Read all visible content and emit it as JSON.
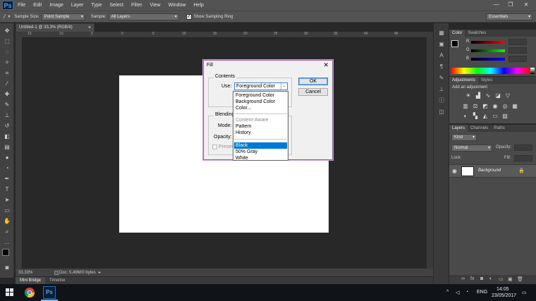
{
  "app": {
    "logo": "Ps",
    "menu": [
      "File",
      "Edit",
      "Image",
      "Layer",
      "Type",
      "Select",
      "Filter",
      "View",
      "Window",
      "Help"
    ]
  },
  "options_bar": {
    "sample_size_label": "Sample Size:",
    "sample_size_value": "Point Sample",
    "sample_label": "Sample:",
    "sample_value": "All Layers",
    "show_ring_label": "Show Sampling Ring",
    "workspace": "Essentials"
  },
  "document": {
    "tab_title": "Untitled-1 @ 33,3% (RGB/8)",
    "zoom": "33,33%",
    "doc_info": "Doc: 5,49M/0 bytes",
    "ruler_ticks": [
      "15",
      "10",
      "5",
      "0",
      "5",
      "10",
      "15",
      "20",
      "25",
      "30",
      "35",
      "40",
      "45"
    ]
  },
  "bottom_tabs": [
    "Mini Bridge",
    "Timeline"
  ],
  "panels": {
    "color_tabs": [
      "Color",
      "Swatches"
    ],
    "color_channels": [
      "R",
      "G",
      "B"
    ],
    "adjust_tabs": [
      "Adjustments",
      "Styles"
    ],
    "add_adjustment": "Add an adjustment",
    "layers_tabs": [
      "Layers",
      "Channels",
      "Paths"
    ],
    "kind_label": "Kind",
    "blend_mode": "Normal",
    "opacity_label": "Opacity:",
    "lock_label": "Lock:",
    "fill_label": "Fill:",
    "layer_name": "Background"
  },
  "fill_dialog": {
    "title": "Fill",
    "contents_group": "Contents",
    "use_label": "Use:",
    "use_value": "Foreground Color",
    "blending_group": "Blending",
    "mode_label": "Mode:",
    "opacity_label": "Opacity:",
    "preserve_label": "Preserve",
    "ok_label": "OK",
    "cancel_label": "Cancel",
    "dropdown_items": [
      {
        "label": "Foreground Color",
        "state": "normal"
      },
      {
        "label": "Background Color",
        "state": "normal"
      },
      {
        "label": "Color...",
        "state": "normal"
      },
      {
        "label": "Content-Aware",
        "state": "disabled"
      },
      {
        "label": "Pattern",
        "state": "normal"
      },
      {
        "label": "History",
        "state": "normal"
      },
      {
        "label": "Black",
        "state": "selected"
      },
      {
        "label": "50% Gray",
        "state": "normal"
      },
      {
        "label": "White",
        "state": "normal"
      }
    ]
  },
  "taskbar": {
    "language": "ENG",
    "time": "14:05",
    "date": "23/05/2017"
  }
}
